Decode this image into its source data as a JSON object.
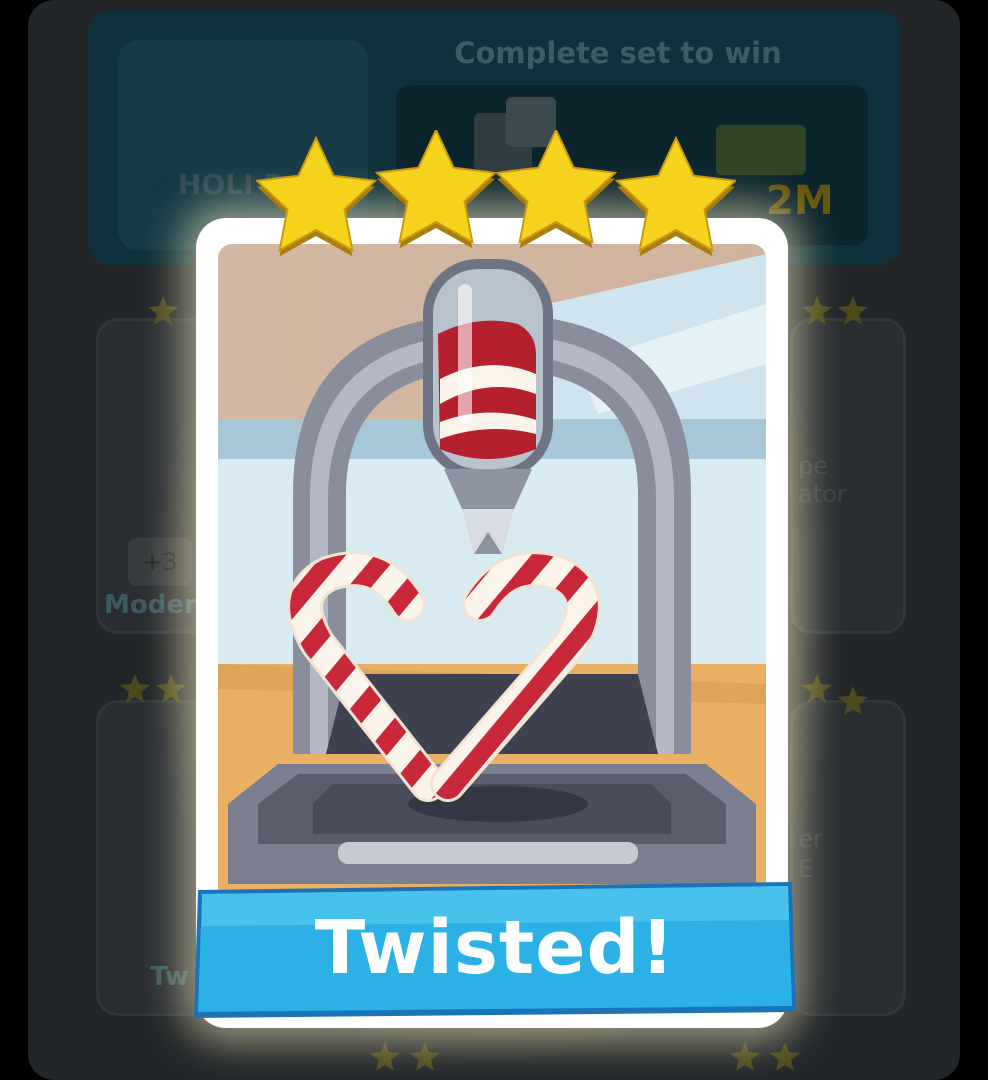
{
  "background": {
    "win_banner_title": "Complete set to win",
    "reward_amount": "2M",
    "set_label": "HOLI B",
    "cards": [
      {
        "label": "Moder",
        "plus": "+3"
      },
      {
        "label": "Tw"
      }
    ],
    "right_text_1": "pe",
    "right_text_2": "ator",
    "right_text_3": "er",
    "right_text_4": "E"
  },
  "card": {
    "name": "Twisted!",
    "stars": 4,
    "colors": {
      "star": "#f5d21c",
      "banner": "#2bb1e6",
      "frame": "#ffffff",
      "candy_red": "#c8283a",
      "machine": "#8a8d9b"
    },
    "icons": [
      "star-icon",
      "piping-bag-icon",
      "candy-cane-heart-icon",
      "machine-arch-icon"
    ]
  }
}
